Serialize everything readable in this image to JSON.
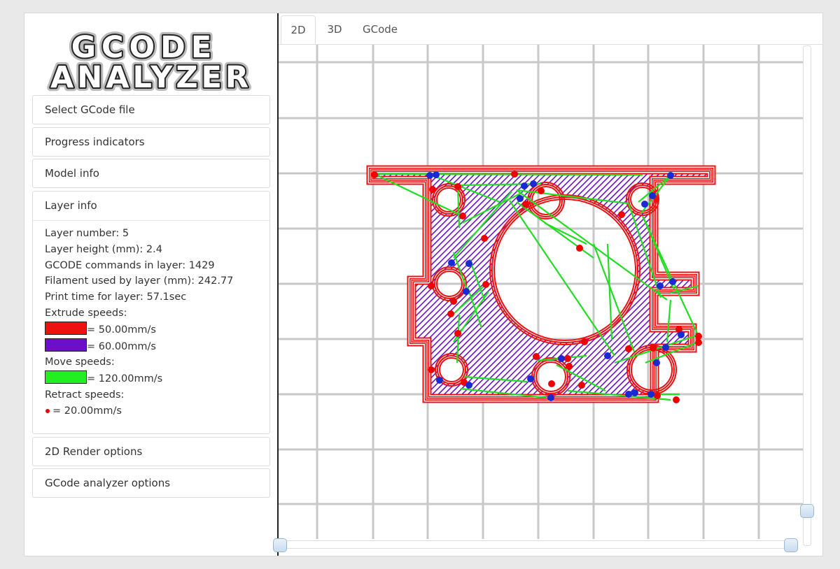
{
  "logo": {
    "line1": "GCODE",
    "line2": "ANALYZER"
  },
  "sidebar": {
    "panels": [
      {
        "label": "Select GCode file"
      },
      {
        "label": "Progress indicators"
      },
      {
        "label": "Model info"
      }
    ],
    "layer_info": {
      "title": "Layer info",
      "layer_number": "Layer number: 5",
      "layer_height": "Layer height (mm): 2.4",
      "commands": "GCODE commands in layer: 1429",
      "filament": "Filament used by layer (mm): 242.77",
      "print_time": "Print time for layer: 57.1sec",
      "extrude_label": "Extrude speeds:",
      "extrude_speeds": [
        {
          "color": "#ee1111",
          "text": "= 50.00mm/s"
        },
        {
          "color": "#6a10c8",
          "text": "= 60.00mm/s"
        }
      ],
      "move_label": "Move speeds:",
      "move_speed": {
        "color": "#22ee22",
        "text": "= 120.00mm/s"
      },
      "retract_label": "Retract speeds:",
      "retract_speed": {
        "color": "#ee0000",
        "text": "= 20.00mm/s"
      }
    },
    "bottom_panels": [
      {
        "label": "2D Render options"
      },
      {
        "label": "GCode analyzer options"
      }
    ]
  },
  "tabs": [
    {
      "label": "2D",
      "active": true
    },
    {
      "label": "3D",
      "active": false
    },
    {
      "label": "GCode",
      "active": false
    }
  ],
  "colors": {
    "perimeter": "#ee1111",
    "infill": "#6a10c8",
    "travel": "#22dd22",
    "retract": "#ee0000",
    "restart": "#1a2ad0",
    "grid": "#c8c8c8"
  }
}
